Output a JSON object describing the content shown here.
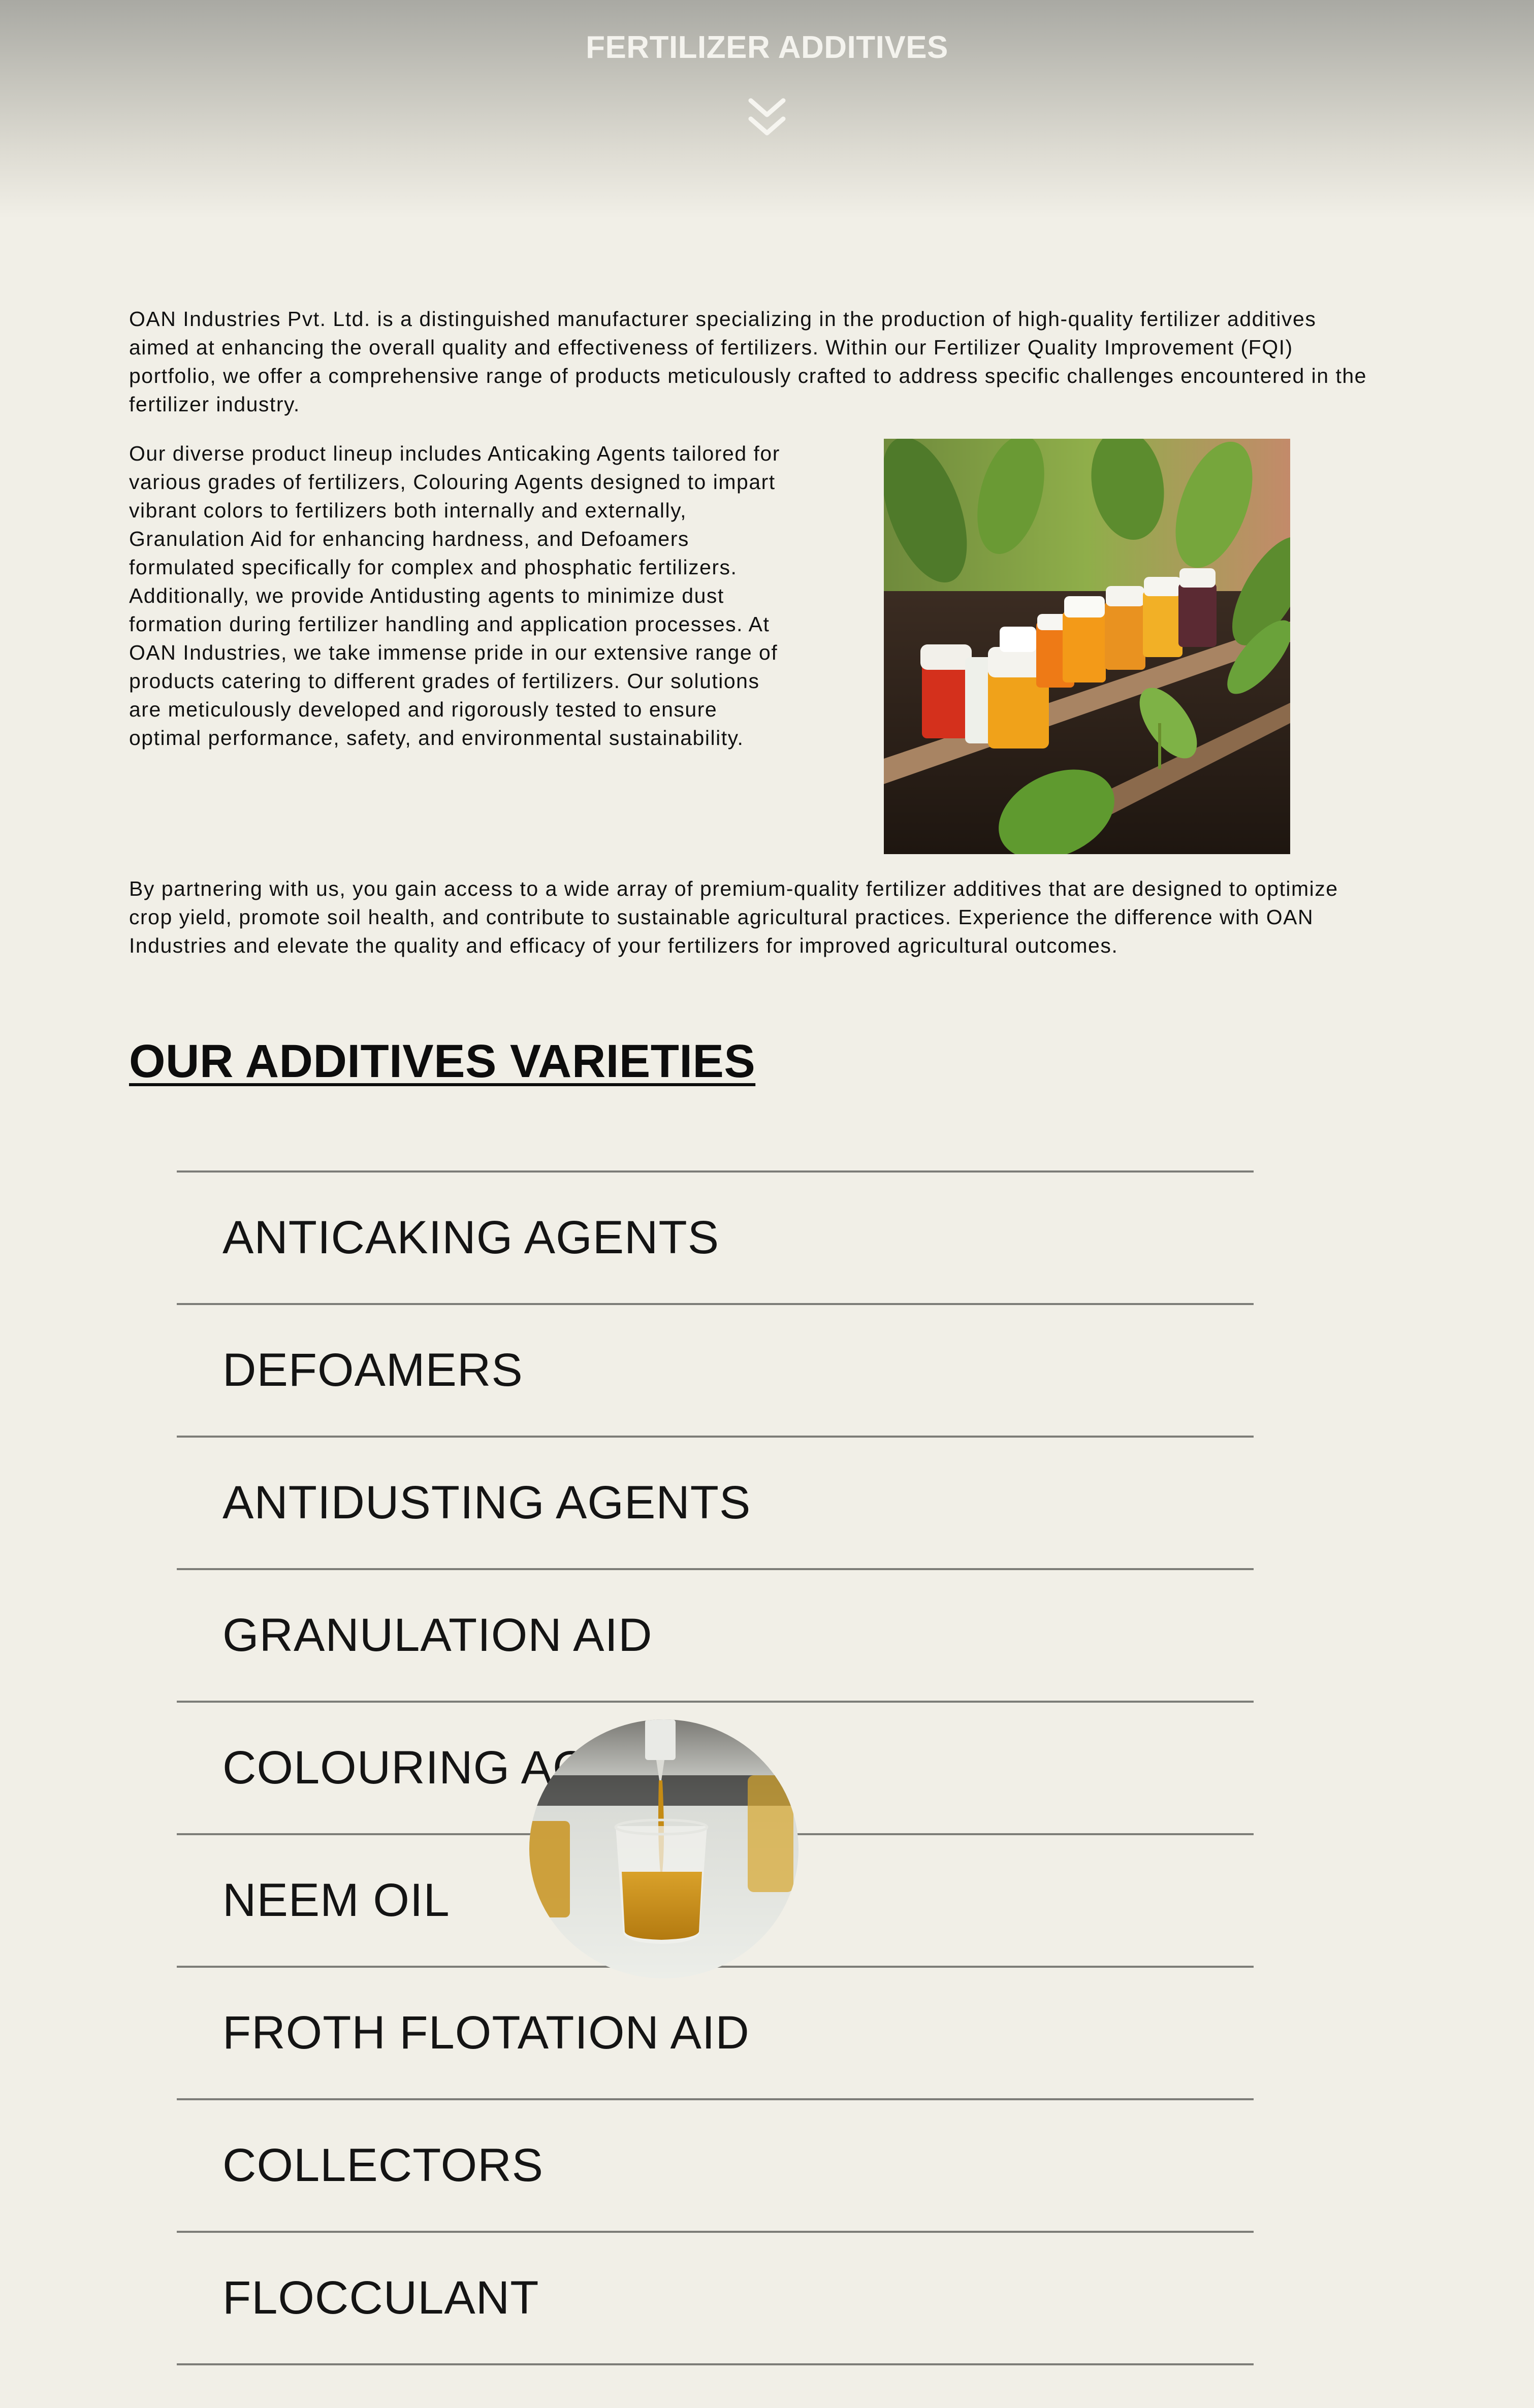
{
  "hero": {
    "title": "FERTILIZER ADDITIVES",
    "scroll_icon": "double-chevron-down-icon"
  },
  "content": {
    "intro": "OAN Industries Pvt. Ltd. is a distinguished manufacturer specializing in the production of high-quality fertilizer additives aimed at enhancing the overall quality and effectiveness of fertilizers. Within our Fertilizer Quality Improvement (FQI) portfolio, we offer a comprehensive range of products meticulously crafted to address specific challenges encountered in the fertilizer industry.",
    "lineup": "Our diverse product lineup includes Anticaking Agents tailored for various grades of fertilizers, Colouring Agents designed to impart vibrant colors to fertilizers both internally and externally, Granulation Aid for enhancing hardness, and Defoamers formulated specifically for complex and phosphatic fertilizers.",
    "additional": "Additionally, we provide Antidusting agents to minimize dust formation during fertilizer handling and application processes. At OAN Industries, we take immense pride in our extensive range of products catering to different grades of fertilizers. Our solutions are meticulously developed and rigorously tested to ensure optimal performance, safety, and environmental sustainability.",
    "partner": "By partnering with us, you gain access to a wide array of premium-quality fertilizer additives that are designed to optimize crop yield, promote soil health, and contribute to sustainable agricultural practices. Experience the difference with OAN Industries and elevate the quality and efficacy of your fertilizers for improved agricultural outcomes."
  },
  "varieties": {
    "heading": "OUR ADDITIVES VARIETIES",
    "items": [
      "ANTICAKING AGENTS",
      "DEFOAMERS",
      "ANTIDUSTING AGENTS",
      "GRANULATION AID",
      "COLOURING AGENTS",
      "NEEM OIL",
      "FROTH FLOTATION AID",
      "COLLECTORS",
      "FLOCCULANT"
    ]
  },
  "colors": {
    "background": "#f1efe7",
    "divider": "#7d7d78",
    "text": "#111111",
    "hero_title": "#f4f3ee"
  }
}
